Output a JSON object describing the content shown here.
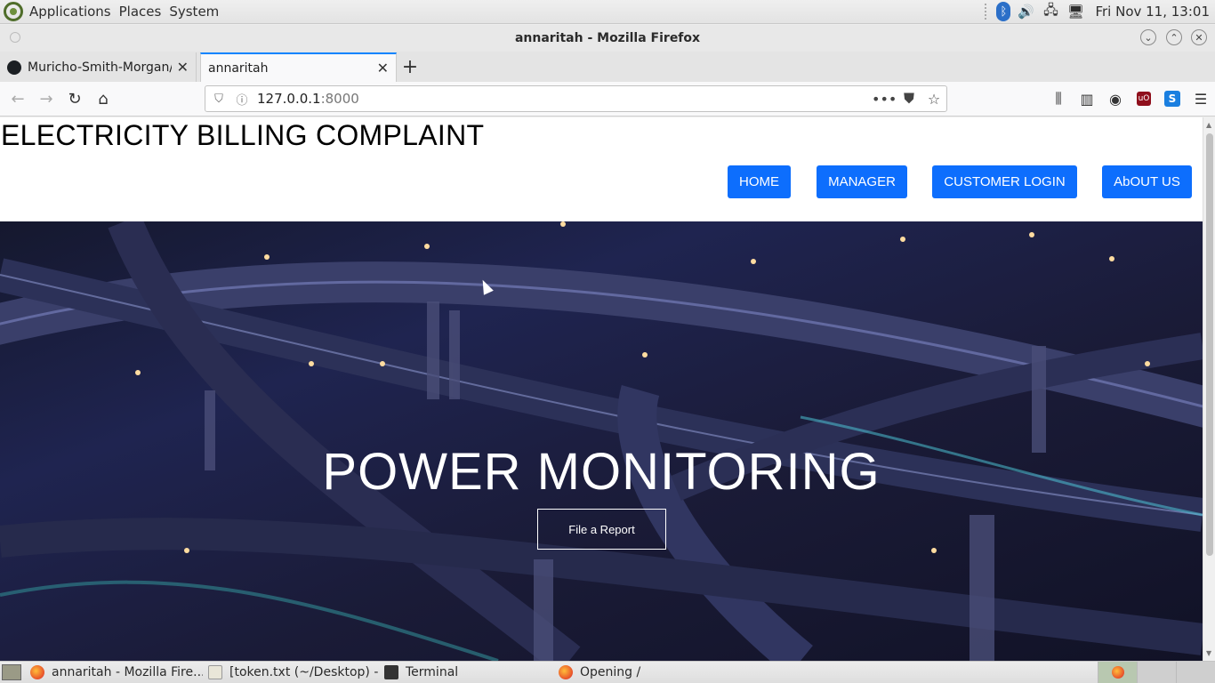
{
  "system_panel": {
    "menus": [
      "Applications",
      "Places",
      "System"
    ],
    "clock": "Fri Nov 11, 13:01"
  },
  "window": {
    "title": "annaritah - Mozilla Firefox"
  },
  "tabs": [
    {
      "label": "Muricho-Smith-Morgan/",
      "active": false
    },
    {
      "label": "annaritah",
      "active": true
    }
  ],
  "urlbar": {
    "host": "127.0.0.1",
    "port": ":8000"
  },
  "site": {
    "title": "ELECTRICITY BILLING COMPLAINT",
    "nav": [
      "HOME",
      "MANAGER",
      "CUSTOMER LOGIN",
      "AbOUT US"
    ],
    "hero_title": "POWER MONITORING",
    "hero_button": "File a Report",
    "accent": "#0d6efd"
  },
  "taskbar": {
    "items": [
      {
        "label": "annaritah - Mozilla Fire...",
        "icon": "firefox-icon"
      },
      {
        "label": "[token.txt (~/Desktop) - ...",
        "icon": "text-editor-icon"
      },
      {
        "label": "Terminal",
        "icon": "terminal-icon"
      },
      {
        "label": "Opening /",
        "icon": "firefox-icon"
      }
    ]
  }
}
